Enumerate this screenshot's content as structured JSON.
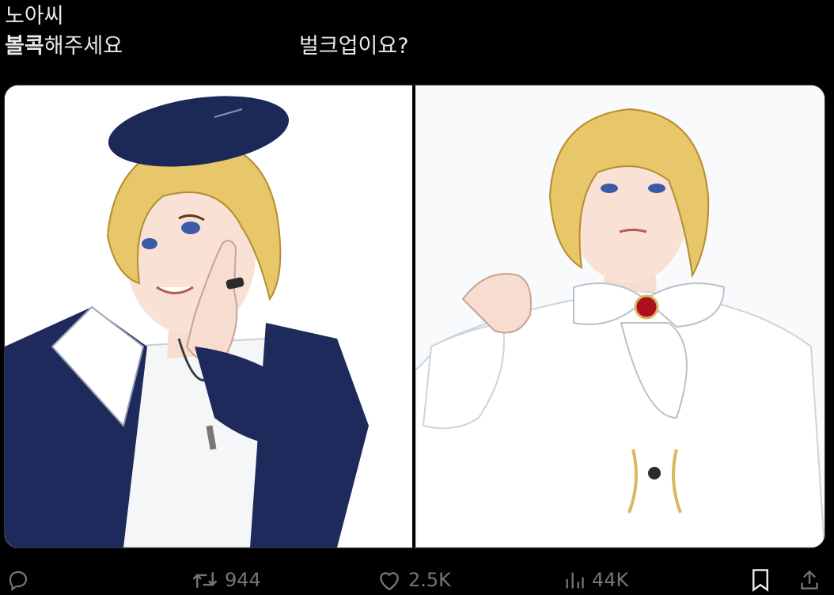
{
  "tweet": {
    "text_line1": "노아씨",
    "caption_left_bold": "볼콕",
    "caption_left_rest": "해주세요",
    "caption_right": "벌크업이요?"
  },
  "actions": {
    "reply": {
      "icon": "reply-icon",
      "count": ""
    },
    "retweet": {
      "icon": "retweet-icon",
      "count": "944"
    },
    "like": {
      "icon": "heart-icon",
      "count": "2.5K"
    },
    "views": {
      "icon": "views-icon",
      "count": "44K"
    },
    "bookmark": {
      "icon": "bookmark-icon"
    },
    "share": {
      "icon": "share-icon"
    }
  },
  "colors": {
    "background": "#000000",
    "text": "#e7e9ea",
    "muted": "#71767b",
    "hair": "#e8c66a",
    "jacket": "#1e2a5c",
    "shirt": "#ffffff",
    "brooch": "#b0101c"
  }
}
